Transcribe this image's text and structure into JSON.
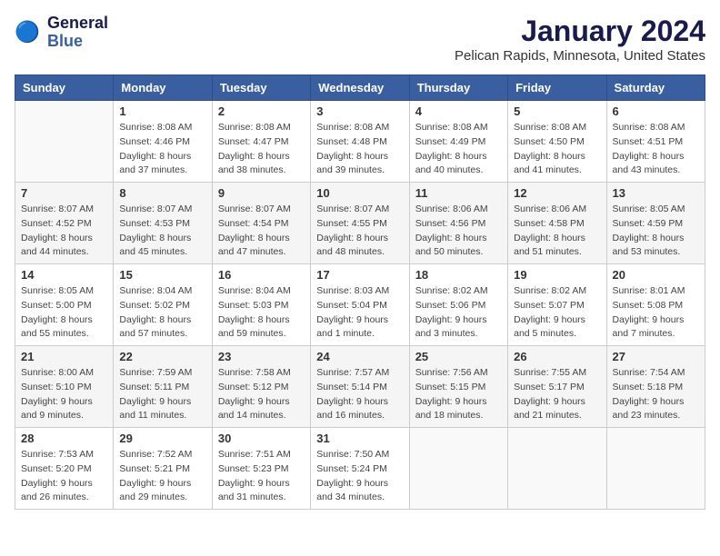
{
  "header": {
    "logo_line1": "General",
    "logo_line2": "Blue",
    "month": "January 2024",
    "location": "Pelican Rapids, Minnesota, United States"
  },
  "weekdays": [
    "Sunday",
    "Monday",
    "Tuesday",
    "Wednesday",
    "Thursday",
    "Friday",
    "Saturday"
  ],
  "weeks": [
    [
      {
        "day": "",
        "info": ""
      },
      {
        "day": "1",
        "info": "Sunrise: 8:08 AM\nSunset: 4:46 PM\nDaylight: 8 hours\nand 37 minutes."
      },
      {
        "day": "2",
        "info": "Sunrise: 8:08 AM\nSunset: 4:47 PM\nDaylight: 8 hours\nand 38 minutes."
      },
      {
        "day": "3",
        "info": "Sunrise: 8:08 AM\nSunset: 4:48 PM\nDaylight: 8 hours\nand 39 minutes."
      },
      {
        "day": "4",
        "info": "Sunrise: 8:08 AM\nSunset: 4:49 PM\nDaylight: 8 hours\nand 40 minutes."
      },
      {
        "day": "5",
        "info": "Sunrise: 8:08 AM\nSunset: 4:50 PM\nDaylight: 8 hours\nand 41 minutes."
      },
      {
        "day": "6",
        "info": "Sunrise: 8:08 AM\nSunset: 4:51 PM\nDaylight: 8 hours\nand 43 minutes."
      }
    ],
    [
      {
        "day": "7",
        "info": "Sunrise: 8:07 AM\nSunset: 4:52 PM\nDaylight: 8 hours\nand 44 minutes."
      },
      {
        "day": "8",
        "info": "Sunrise: 8:07 AM\nSunset: 4:53 PM\nDaylight: 8 hours\nand 45 minutes."
      },
      {
        "day": "9",
        "info": "Sunrise: 8:07 AM\nSunset: 4:54 PM\nDaylight: 8 hours\nand 47 minutes."
      },
      {
        "day": "10",
        "info": "Sunrise: 8:07 AM\nSunset: 4:55 PM\nDaylight: 8 hours\nand 48 minutes."
      },
      {
        "day": "11",
        "info": "Sunrise: 8:06 AM\nSunset: 4:56 PM\nDaylight: 8 hours\nand 50 minutes."
      },
      {
        "day": "12",
        "info": "Sunrise: 8:06 AM\nSunset: 4:58 PM\nDaylight: 8 hours\nand 51 minutes."
      },
      {
        "day": "13",
        "info": "Sunrise: 8:05 AM\nSunset: 4:59 PM\nDaylight: 8 hours\nand 53 minutes."
      }
    ],
    [
      {
        "day": "14",
        "info": "Sunrise: 8:05 AM\nSunset: 5:00 PM\nDaylight: 8 hours\nand 55 minutes."
      },
      {
        "day": "15",
        "info": "Sunrise: 8:04 AM\nSunset: 5:02 PM\nDaylight: 8 hours\nand 57 minutes."
      },
      {
        "day": "16",
        "info": "Sunrise: 8:04 AM\nSunset: 5:03 PM\nDaylight: 8 hours\nand 59 minutes."
      },
      {
        "day": "17",
        "info": "Sunrise: 8:03 AM\nSunset: 5:04 PM\nDaylight: 9 hours\nand 1 minute."
      },
      {
        "day": "18",
        "info": "Sunrise: 8:02 AM\nSunset: 5:06 PM\nDaylight: 9 hours\nand 3 minutes."
      },
      {
        "day": "19",
        "info": "Sunrise: 8:02 AM\nSunset: 5:07 PM\nDaylight: 9 hours\nand 5 minutes."
      },
      {
        "day": "20",
        "info": "Sunrise: 8:01 AM\nSunset: 5:08 PM\nDaylight: 9 hours\nand 7 minutes."
      }
    ],
    [
      {
        "day": "21",
        "info": "Sunrise: 8:00 AM\nSunset: 5:10 PM\nDaylight: 9 hours\nand 9 minutes."
      },
      {
        "day": "22",
        "info": "Sunrise: 7:59 AM\nSunset: 5:11 PM\nDaylight: 9 hours\nand 11 minutes."
      },
      {
        "day": "23",
        "info": "Sunrise: 7:58 AM\nSunset: 5:12 PM\nDaylight: 9 hours\nand 14 minutes."
      },
      {
        "day": "24",
        "info": "Sunrise: 7:57 AM\nSunset: 5:14 PM\nDaylight: 9 hours\nand 16 minutes."
      },
      {
        "day": "25",
        "info": "Sunrise: 7:56 AM\nSunset: 5:15 PM\nDaylight: 9 hours\nand 18 minutes."
      },
      {
        "day": "26",
        "info": "Sunrise: 7:55 AM\nSunset: 5:17 PM\nDaylight: 9 hours\nand 21 minutes."
      },
      {
        "day": "27",
        "info": "Sunrise: 7:54 AM\nSunset: 5:18 PM\nDaylight: 9 hours\nand 23 minutes."
      }
    ],
    [
      {
        "day": "28",
        "info": "Sunrise: 7:53 AM\nSunset: 5:20 PM\nDaylight: 9 hours\nand 26 minutes."
      },
      {
        "day": "29",
        "info": "Sunrise: 7:52 AM\nSunset: 5:21 PM\nDaylight: 9 hours\nand 29 minutes."
      },
      {
        "day": "30",
        "info": "Sunrise: 7:51 AM\nSunset: 5:23 PM\nDaylight: 9 hours\nand 31 minutes."
      },
      {
        "day": "31",
        "info": "Sunrise: 7:50 AM\nSunset: 5:24 PM\nDaylight: 9 hours\nand 34 minutes."
      },
      {
        "day": "",
        "info": ""
      },
      {
        "day": "",
        "info": ""
      },
      {
        "day": "",
        "info": ""
      }
    ]
  ]
}
